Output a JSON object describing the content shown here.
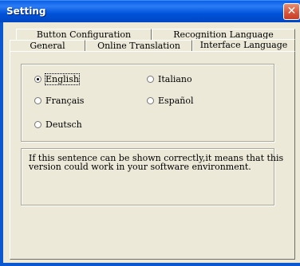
{
  "window": {
    "title": "Setting",
    "close_glyph": "✕"
  },
  "tabs": {
    "row_back": [
      "Button Configuration",
      "Recognition Language"
    ],
    "row_front": [
      "General",
      "Online Translation",
      "Interface Language"
    ],
    "active": "Interface Language"
  },
  "language_options": [
    {
      "label": "English",
      "selected": true
    },
    {
      "label": "Italiano",
      "selected": false
    },
    {
      "label": "Français",
      "selected": false
    },
    {
      "label": "Español",
      "selected": false
    },
    {
      "label": "Deutsch",
      "selected": false
    }
  ],
  "message": "If this sentence can be shown correctly,it means that this version could work in your software environment.",
  "colors": {
    "titlebar": "#0052d9",
    "close_button": "#d5553a",
    "dialog_bg": "#ece9d8"
  }
}
